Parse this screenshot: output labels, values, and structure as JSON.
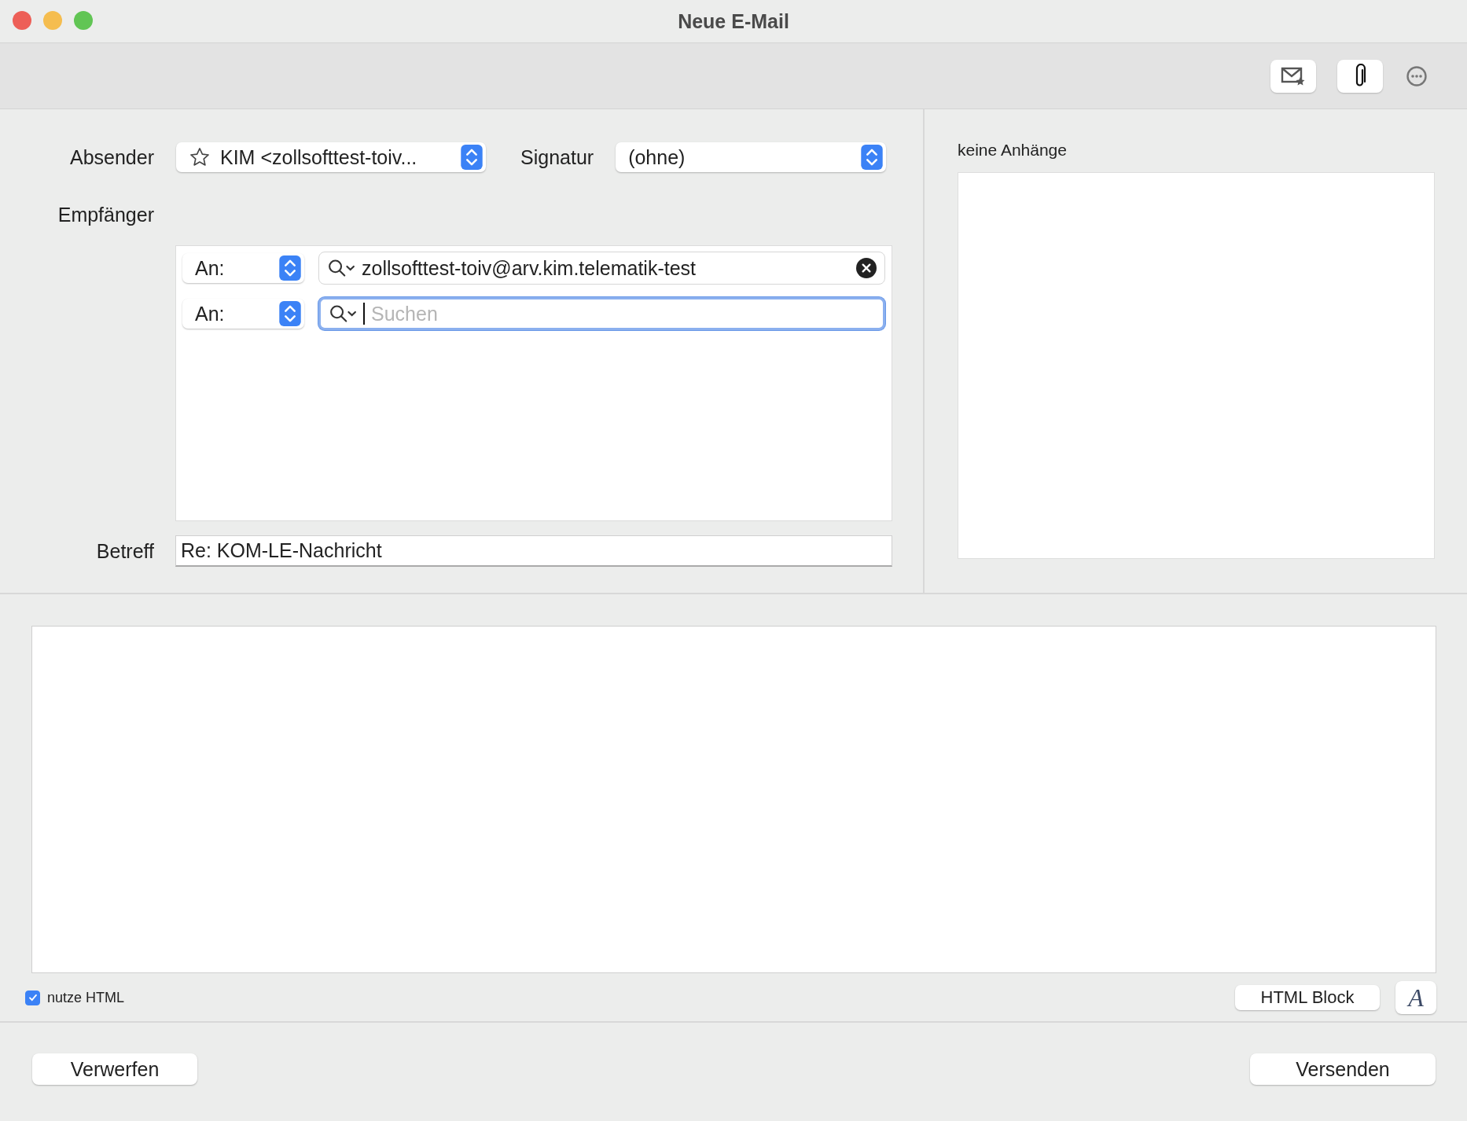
{
  "window": {
    "title": "Neue E-Mail"
  },
  "sender": {
    "label": "Absender",
    "value": "KIM <zollsofttest-toiv..."
  },
  "signature": {
    "label": "Signatur",
    "value": "(ohne)"
  },
  "recipients": {
    "label": "Empfänger",
    "rows": [
      {
        "type": "An:",
        "value": "zollsofttest-toiv@arv.kim.telematik-test",
        "focused": false
      },
      {
        "type": "An:",
        "placeholder": "Suchen",
        "focused": true
      }
    ]
  },
  "subject": {
    "label": "Betreff",
    "value": "Re: KOM-LE-Nachricht"
  },
  "attachments": {
    "label": "keine Anhänge"
  },
  "html_option": {
    "label": "nutze HTML",
    "checked": true
  },
  "html_block_button": "HTML Block",
  "font_button": "A",
  "discard_button": "Verwerfen",
  "send_button": "Versenden"
}
